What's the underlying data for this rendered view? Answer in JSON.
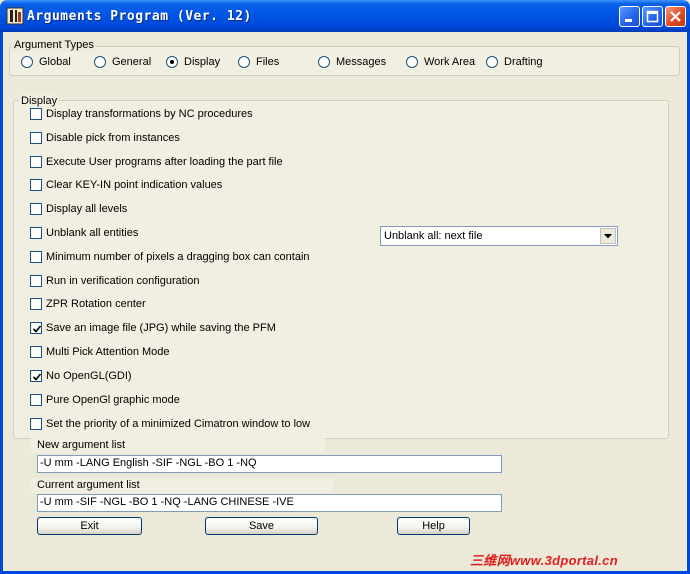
{
  "window": {
    "title": "Arguments Program (Ver. 12)"
  },
  "argument_types": {
    "legend": "Argument Types",
    "options": [
      {
        "label": "Global",
        "selected": false
      },
      {
        "label": "General",
        "selected": false
      },
      {
        "label": "Display",
        "selected": true
      },
      {
        "label": "Files",
        "selected": false
      },
      {
        "label": "Messages",
        "selected": false
      },
      {
        "label": "Work Area",
        "selected": false
      },
      {
        "label": "Drafting",
        "selected": false
      }
    ]
  },
  "display": {
    "legend": "Display",
    "checkboxes": [
      {
        "label": "Display transformations by NC procedures",
        "checked": false
      },
      {
        "label": "Disable pick from instances",
        "checked": false
      },
      {
        "label": "Execute User programs after loading the part file",
        "checked": false
      },
      {
        "label": "Clear KEY-IN point indication values",
        "checked": false
      },
      {
        "label": "Display all levels",
        "checked": false
      },
      {
        "label": "Unblank all entities",
        "checked": false
      },
      {
        "label": "Minimum number of pixels a dragging box can contain",
        "checked": false
      },
      {
        "label": "Run in verification configuration",
        "checked": false
      },
      {
        "label": "ZPR Rotation center",
        "checked": false
      },
      {
        "label": "Save an image file (JPG) while saving the PFM",
        "checked": true
      },
      {
        "label": "Multi Pick Attention Mode",
        "checked": false
      },
      {
        "label": "No OpenGL(GDI)",
        "checked": true
      },
      {
        "label": "Pure OpenGl graphic mode",
        "checked": false
      },
      {
        "label": "Set the priority of a minimized Cimatron window to low",
        "checked": false
      }
    ],
    "unblank_dropdown": "Unblank all: next file"
  },
  "new_argument": {
    "label": "New argument list",
    "value": "-U mm -LANG English -SIF  -NGL  -BO 1 -NQ"
  },
  "current_argument": {
    "label": "Current argument list",
    "value": "-U mm -SIF -NGL -BO 1 -NQ -LANG CHINESE -IVE"
  },
  "buttons": {
    "exit": "Exit",
    "save": "Save",
    "help": "Help"
  },
  "watermark": "三维网www.3dportal.cn",
  "colors": {
    "titlebar": "#0055e5",
    "window_bg": "#ece9d8",
    "watermark": "#e02020"
  }
}
